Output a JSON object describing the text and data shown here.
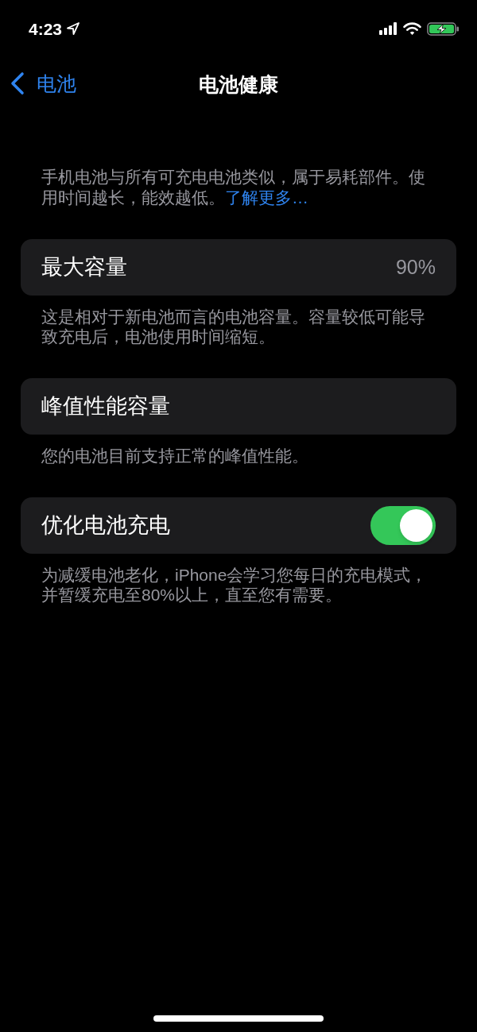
{
  "status_bar": {
    "time": "4:23"
  },
  "nav": {
    "back_label": "电池",
    "title": "电池健康"
  },
  "intro": {
    "text": "手机电池与所有可充电电池类似，属于易耗部件。使用时间越长，能效越低。",
    "link": "了解更多…"
  },
  "sections": [
    {
      "kind": "value",
      "label": "最大容量",
      "value": "90%",
      "footer": "这是相对于新电池而言的电池容量。容量较低可能导致充电后，电池使用时间缩短。"
    },
    {
      "kind": "plain",
      "label": "峰值性能容量",
      "footer": "您的电池目前支持正常的峰值性能。"
    },
    {
      "kind": "toggle",
      "label": "优化电池充电",
      "on": true,
      "footer": "为减缓电池老化，iPhone会学习您每日的充电模式，并暂缓充电至80%以上，直至您有需要。"
    }
  ]
}
